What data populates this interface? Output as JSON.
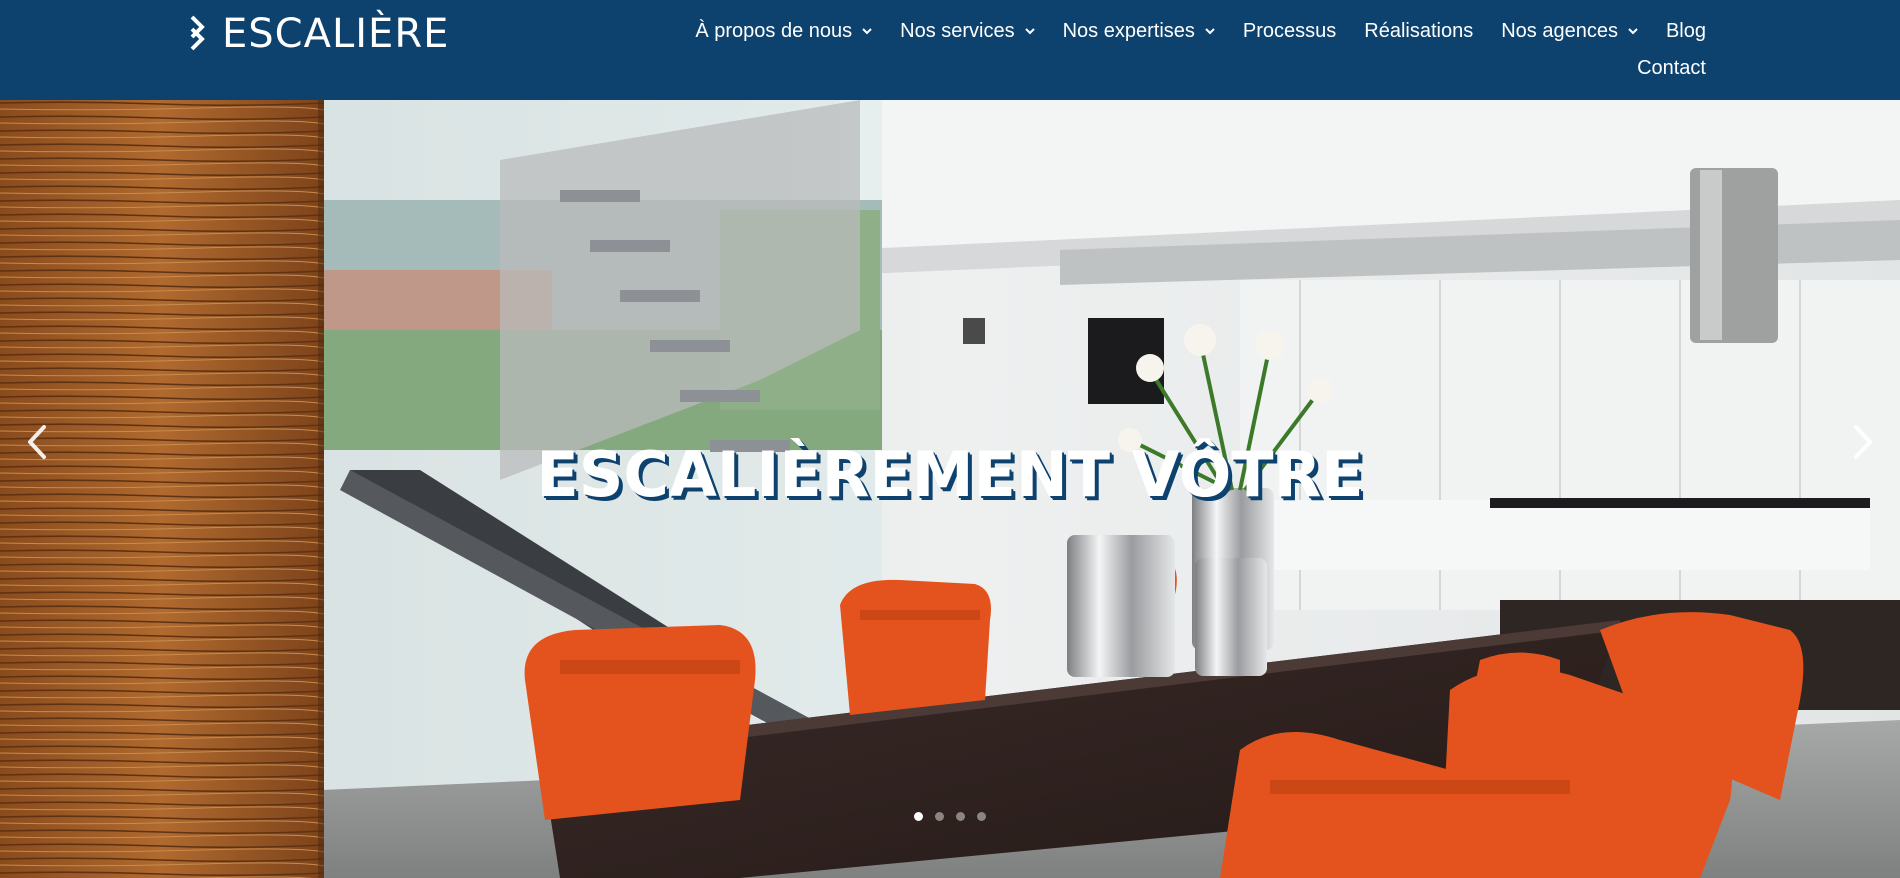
{
  "brand": {
    "name": "ESCALIÈRE",
    "logo_icon": "stair-stripes-icon"
  },
  "nav": {
    "row1": [
      {
        "label": "À propos de nous",
        "dropdown": true
      },
      {
        "label": "Nos services",
        "dropdown": true
      },
      {
        "label": "Nos expertises",
        "dropdown": true
      },
      {
        "label": "Processus",
        "dropdown": false
      },
      {
        "label": "Réalisations",
        "dropdown": false
      },
      {
        "label": "Nos agences",
        "dropdown": true
      },
      {
        "label": "Blog",
        "dropdown": false
      }
    ],
    "row2": [
      {
        "label": "Contact",
        "dropdown": false
      }
    ]
  },
  "hero": {
    "title": "ESCALIÈREMENT VÔTRE",
    "slide_count": 4,
    "active_slide": 1,
    "prev_icon": "chevron-left-icon",
    "next_icon": "chevron-right-icon"
  },
  "colors": {
    "header_bg": "#0d426f",
    "title_shadow": "#0d426f",
    "chair_orange": "#e4531d",
    "wood": "#9a5a25"
  }
}
